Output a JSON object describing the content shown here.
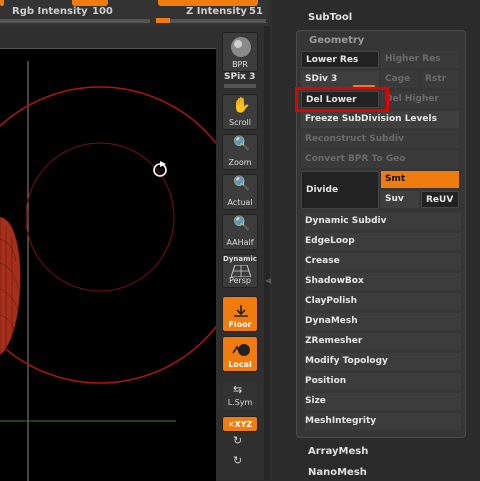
{
  "topbar": {
    "rgb_intensity_label": "Rgb Intensity",
    "rgb_intensity_value": "100",
    "z_intensity_label": "Z Intensity",
    "z_intensity_value": "51"
  },
  "toolbar": {
    "bpr_label": "BPR",
    "spix_label": "SPix 3",
    "scroll_label": "Scroll",
    "zoom_label": "Zoom",
    "actual_label": "Actual",
    "aahalf_label": "AAHalf",
    "dynamic_label": "Dynamic",
    "persp_label": "Persp",
    "floor_label": "Floor",
    "local_label": "Local",
    "lsym_label": "L.Sym",
    "xyz_label": "✕XYZ"
  },
  "palette": {
    "subtool": "SubTool",
    "geometry_title": "Geometry",
    "lower_res": "Lower Res",
    "higher_res": "Higher Res",
    "sdiv": "SDiv 3",
    "cage": "Cage",
    "rstr": "Rstr",
    "del_lower": "Del Lower",
    "del_higher": "Del Higher",
    "freeze_subdiv": "Freeze SubDivision Levels",
    "reconstruct_subdiv": "Reconstruct Subdiv",
    "convert_bpr": "Convert BPR To Geo",
    "divide": "Divide",
    "smt": "Smt",
    "suv": "Suv",
    "reuv": "ReUV",
    "items": [
      "Dynamic Subdiv",
      "EdgeLoop",
      "Crease",
      "ShadowBox",
      "ClayPolish",
      "DynaMesh",
      "ZRemesher",
      "Modify Topology",
      "Position",
      "Size",
      "MeshIntegrity"
    ],
    "array_mesh": "ArrayMesh",
    "nano_mesh": "NanoMesh"
  },
  "colors": {
    "accent": "#f07c10",
    "highlight": "#e00000",
    "viewport_bg": "#000000",
    "mesh": "#b8321c"
  }
}
